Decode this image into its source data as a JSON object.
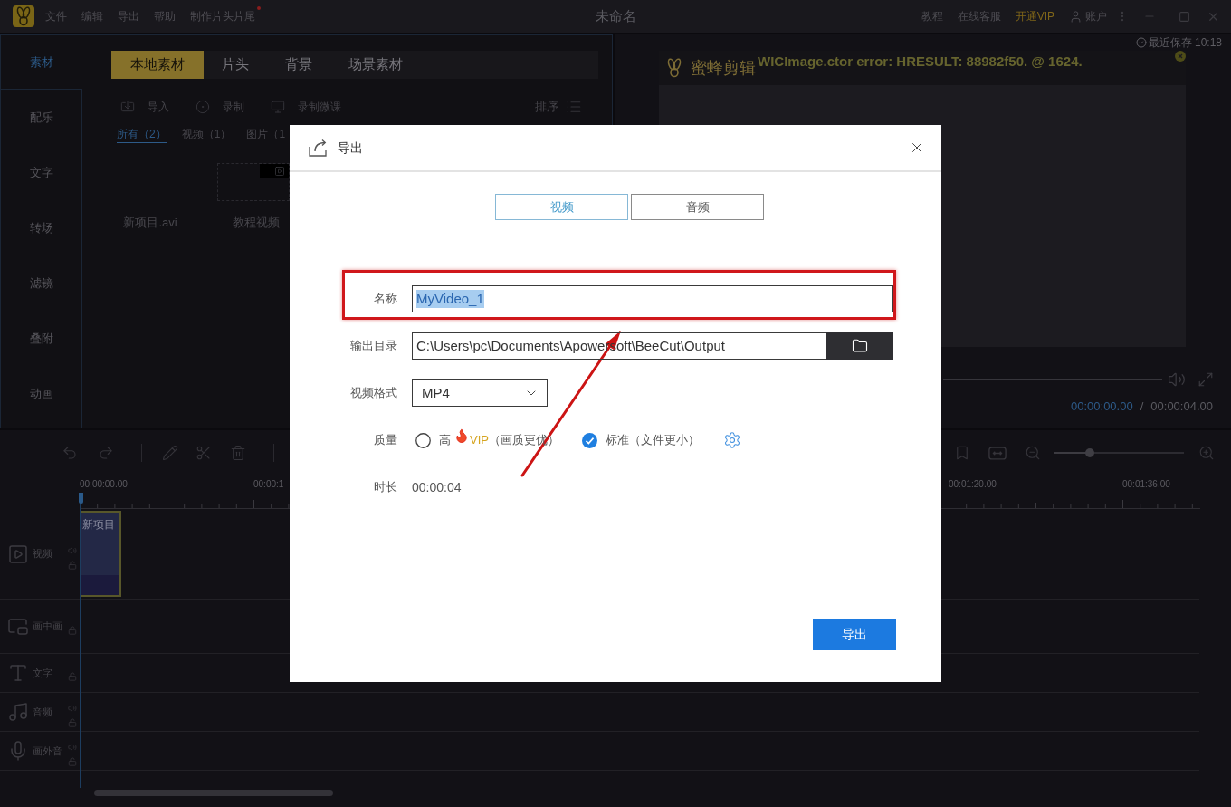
{
  "title_bar": {
    "menu": [
      {
        "label": "文件",
        "dot": false
      },
      {
        "label": "编辑",
        "dot": false
      },
      {
        "label": "导出",
        "dot": false
      },
      {
        "label": "帮助",
        "dot": false
      },
      {
        "label": "制作片头片尾",
        "dot": true
      }
    ],
    "title": "未命名",
    "links": [
      {
        "label": "教程",
        "kind": "link"
      },
      {
        "label": "在线客服",
        "kind": "link"
      },
      {
        "label": "开通VIP",
        "kind": "vip"
      },
      {
        "label": "账户",
        "kind": "account"
      }
    ]
  },
  "sidebar": {
    "items": [
      {
        "label": "素材",
        "selected": true
      },
      {
        "label": "配乐",
        "selected": false
      },
      {
        "label": "文字",
        "selected": false
      },
      {
        "label": "转场",
        "selected": false
      },
      {
        "label": "滤镜",
        "selected": false
      },
      {
        "label": "叠附",
        "selected": false
      },
      {
        "label": "动画",
        "selected": false
      }
    ]
  },
  "media_panel": {
    "tabs": [
      {
        "label": "本地素材",
        "selected": true
      },
      {
        "label": "片头",
        "selected": false
      },
      {
        "label": "背景",
        "selected": false
      },
      {
        "label": "场景素材",
        "selected": false
      }
    ],
    "actions": [
      {
        "label": "导入",
        "kind": "import"
      },
      {
        "label": "录制",
        "kind": "record"
      },
      {
        "label": "录制微课",
        "kind": "screen"
      }
    ],
    "sort": "排序",
    "filters": [
      {
        "label": "所有（2）",
        "selected": true
      },
      {
        "label": "视频（1）",
        "selected": false
      },
      {
        "label": "图片（1",
        "selected": false
      }
    ],
    "items": [
      {
        "name": "新项目.avi",
        "kind": "blank"
      },
      {
        "name": "教程视频",
        "kind": "clip"
      }
    ]
  },
  "preview": {
    "saved": "最近保存 10:18",
    "brand": "蜜蜂剪辑",
    "error": "WICImage.ctor error: HRESULT: 88982f50. @ 1624.",
    "time_current": "00:00:00.00",
    "time_separator": "/",
    "time_total": "00:00:04.00"
  },
  "timeline": {
    "zoom_slider": {
      "level": 0.27
    },
    "ruler": {
      "labels_start": [
        "00:00:00.00",
        "00:00:1"
      ],
      "labels_end": [
        "00:01:20.00",
        "00:01:36.00"
      ]
    },
    "tracks": [
      {
        "label": "视频",
        "kind": "video",
        "speaker": true,
        "clips": [
          {
            "label": "新项目"
          }
        ]
      },
      {
        "label": "画中画",
        "kind": "pip",
        "speaker": false
      },
      {
        "label": "文字",
        "kind": "text",
        "speaker": false
      },
      {
        "label": "音频",
        "kind": "audio",
        "speaker": true
      },
      {
        "label": "画外音",
        "kind": "voice",
        "speaker": true
      }
    ]
  },
  "dialog": {
    "title": "导出",
    "tabs": [
      {
        "label": "视频",
        "selected": true
      },
      {
        "label": "音频",
        "selected": false
      }
    ],
    "fields": [
      {
        "kind": "text",
        "label": "名称",
        "value": "MyVideo_1",
        "value_selected": true
      },
      {
        "kind": "folder",
        "label": "输出目录",
        "value": "C:\\Users\\pc\\Documents\\Apowersoft\\BeeCut\\Output"
      },
      {
        "kind": "select",
        "label": "视频格式",
        "value": "MP4"
      },
      {
        "kind": "radio",
        "label": "质量",
        "options": [
          {
            "label": "高",
            "vip": "VIP",
            "note": "（画质更优）",
            "selected": false
          },
          {
            "label": "标准（文件更小）",
            "selected": true
          }
        ]
      },
      {
        "kind": "static",
        "label": "时长",
        "value": "00:00:04"
      }
    ],
    "button": "导出"
  }
}
